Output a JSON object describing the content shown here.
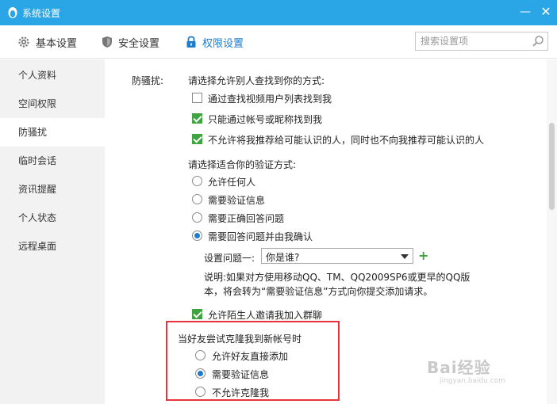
{
  "window": {
    "title": "系统设置",
    "minimize": "—",
    "close": "✕"
  },
  "toolbar": {
    "tabs": [
      {
        "label": "基本设置",
        "icon": "gear-icon"
      },
      {
        "label": "安全设置",
        "icon": "shield-icon"
      },
      {
        "label": "权限设置",
        "icon": "lock-icon",
        "active": true
      }
    ],
    "search_placeholder": "搜索设置项"
  },
  "sidebar": {
    "items": [
      {
        "label": "个人资料"
      },
      {
        "label": "空间权限"
      },
      {
        "label": "防骚扰",
        "active": true
      },
      {
        "label": "临时会话"
      },
      {
        "label": "资讯提醒"
      },
      {
        "label": "个人状态"
      },
      {
        "label": "远程桌面"
      }
    ]
  },
  "main": {
    "section_label": "防骚扰:",
    "find_heading": "请选择允许别人查找到你的方式:",
    "find_options": [
      {
        "label": "通过查找视频用户列表找到我",
        "checked": false
      },
      {
        "label": "只能通过帐号或昵称找到我",
        "checked": true
      },
      {
        "label": "不允许将我推荐给可能认识的人，同时也不向我推荐可能认识的人",
        "checked": true
      }
    ],
    "verify_heading": "请选择适合你的验证方式:",
    "verify_options": [
      {
        "label": "允许任何人",
        "checked": false
      },
      {
        "label": "需要验证信息",
        "checked": false
      },
      {
        "label": "需要正确回答问题",
        "checked": false
      },
      {
        "label": "需要回答问题并由我确认",
        "checked": true
      }
    ],
    "question_label": "设置问题一:",
    "question_value": "你是谁?",
    "add_question": "+",
    "note_line1": "说明:如果对方使用移动QQ、TM、QQ2009SP6或更早的QQ版",
    "note_line2": "本，将会转为“需要验证信息”方式向你提交添加请求。",
    "group_invite": {
      "label": "允许陌生人邀请我加入群聊",
      "checked": true
    },
    "clone_heading": "当好友尝试克隆我到新帐号时",
    "clone_options": [
      {
        "label": "允许好友直接添加",
        "checked": false
      },
      {
        "label": "需要验证信息",
        "checked": true
      },
      {
        "label": "不允许克隆我",
        "checked": false
      }
    ]
  },
  "watermark": {
    "text": "Bai经验",
    "sub": "jingyan.baidu.com"
  },
  "colors": {
    "titlebar": "#2aa6e6",
    "accent": "#1e7ccd",
    "check_green": "#3fa33f",
    "highlight_red": "#e8333c"
  }
}
